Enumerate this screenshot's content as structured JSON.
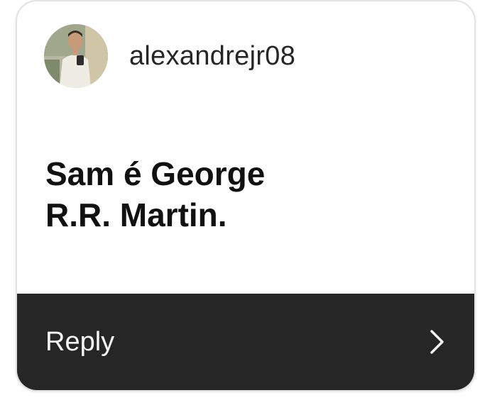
{
  "comment": {
    "username": "alexandrejr08",
    "avatar_icon": "user-avatar-photo",
    "text_lines": [
      "Sam é George",
      "R.R. Martin."
    ]
  },
  "reply_bar": {
    "label": "Reply",
    "icon": "chevron-right-icon",
    "background": "#262626",
    "text_color": "#f5f5f5"
  }
}
